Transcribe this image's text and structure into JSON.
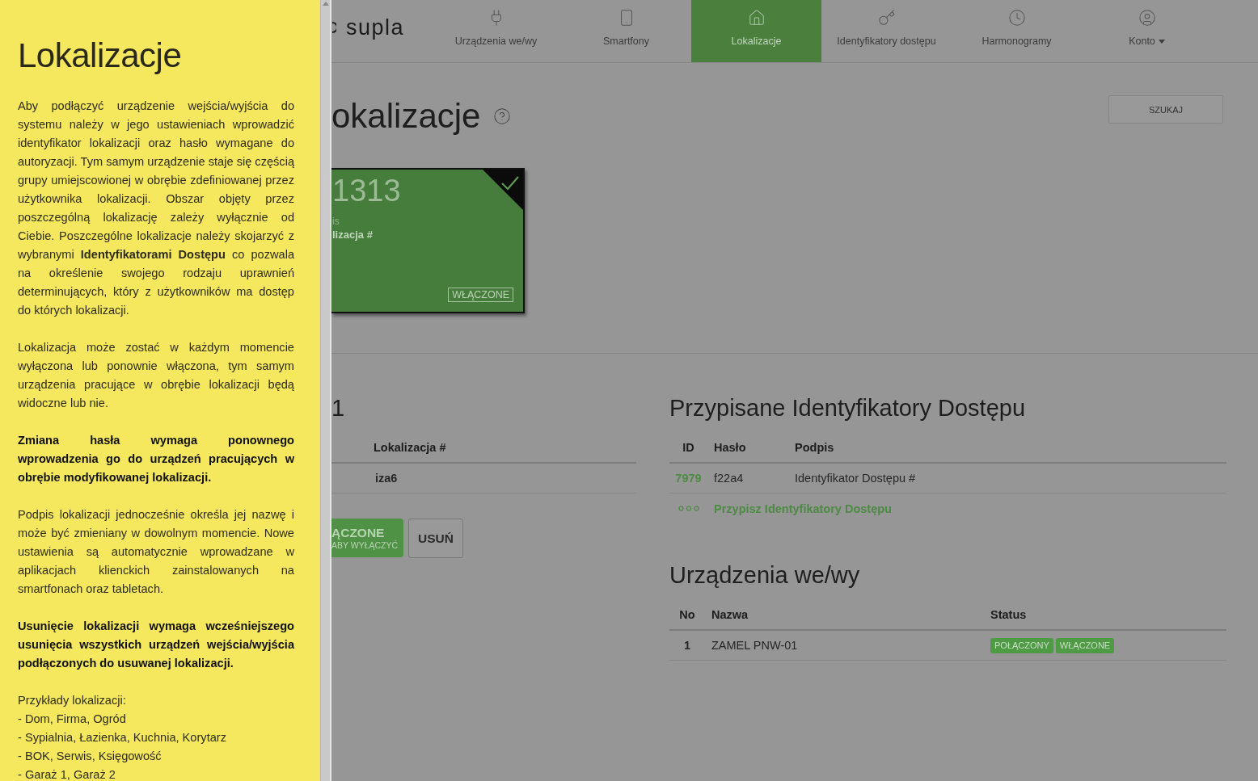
{
  "help_panel": {
    "title": "Lokalizacje",
    "paragraphs": [
      {
        "text": "Aby podłączyć urządzenie wejścia/wyjścia do systemu należy w jego ustawieniach wprowadzić identyfikator lokalizacji oraz hasło wymagane do autoryzacji. Tym samym urządzenie staje się częścią grupy umiejscowionej w obrębie zdefiniowanej przez użytkownika lokalizacji. Obszar objęty przez poszczególną lokalizację zależy wyłącznie od Ciebie. Poszczególne lokalizacje należy skojarzyć z wybranymi **Identyfikatorami Dostępu** co pozwala na określenie swojego rodzaju uprawnień determinujących, który z użytkowników ma dostęp do których lokalizacji.",
        "bold": false
      },
      {
        "text": "Lokalizacja może zostać w każdym momencie wyłączona lub ponownie włączona, tym samym urządzenia pracujące w obrębie lokalizacji będą widoczne lub nie.",
        "bold": false
      },
      {
        "text": "Zmiana hasła wymaga ponownego wprowadzenia go do urządzeń pracujących w obrębie modyfikowanej lokalizacji.",
        "bold": true
      },
      {
        "text": "Podpis lokalizacji jednocześnie określa jej nazwę i może być zmieniany w dowolnym momencie. Nowe ustawienia są automatycznie wprowadzane w aplikacjach klienckich zainstalowanych na smartfonach oraz tabletach.",
        "bold": false
      },
      {
        "text": "Usunięcie lokalizacji wymaga wcześniejszego usunięcia wszystkich urządzeń wejścia/wyjścia podłączonych do usuwanej lokalizacji.",
        "bold": true
      }
    ],
    "examples_title": "Przykłady lokalizacji:",
    "examples": [
      "- Dom, Firma, Ogród",
      "- Sypialnia, Łazienka, Kuchnia, Korytarz",
      "- BOK, Serwis, Księgowość",
      "- Garaż 1, Garaż 2"
    ]
  },
  "header": {
    "logo_text": "supla",
    "nav": [
      {
        "label": "Urządzenia we/wy",
        "selected": false,
        "dropdown": false
      },
      {
        "label": "Smartfony",
        "selected": false,
        "dropdown": false
      },
      {
        "label": "Lokalizacje",
        "selected": true,
        "dropdown": false
      },
      {
        "label": "Identyfikatory dostępu",
        "selected": false,
        "dropdown": false
      },
      {
        "label": "Harmonogramy",
        "selected": false,
        "dropdown": false
      },
      {
        "label": "Konto",
        "selected": false,
        "dropdown": true
      }
    ]
  },
  "page": {
    "title": "okalizacje",
    "search_button": "SZUKAJ"
  },
  "location_card": {
    "id": "1313",
    "caption_label": "is",
    "caption": "lizacja #",
    "status": "WŁĄCZONE",
    "enabled": true,
    "selected": true
  },
  "location_details": {
    "heading": "1",
    "columns": [
      "Lokalizacja #"
    ],
    "rows": [
      [
        "iza6"
      ]
    ],
    "toggle_button": {
      "label": "ĄCZONE",
      "hint": "ABY WYŁĄCZYĆ",
      "on": true
    },
    "delete_button": "USUŃ"
  },
  "access_ids": {
    "heading": "Przypisane Identyfikatory Dostępu",
    "columns": [
      "ID",
      "Hasło",
      "Podpis"
    ],
    "rows": [
      {
        "id": "7979",
        "password": "f22a4",
        "caption": "Identyfikator Dostępu #"
      }
    ],
    "assign_link": "Przypisz Identyfikatory Dostępu"
  },
  "devices": {
    "heading": "Urządzenia we/wy",
    "columns": [
      "No",
      "Nazwa",
      "Status"
    ],
    "rows": [
      {
        "no": "1",
        "name": "ZAMEL PNW-01",
        "statuses": [
          "POŁĄCZONY",
          "WŁĄCZONE"
        ]
      }
    ]
  }
}
